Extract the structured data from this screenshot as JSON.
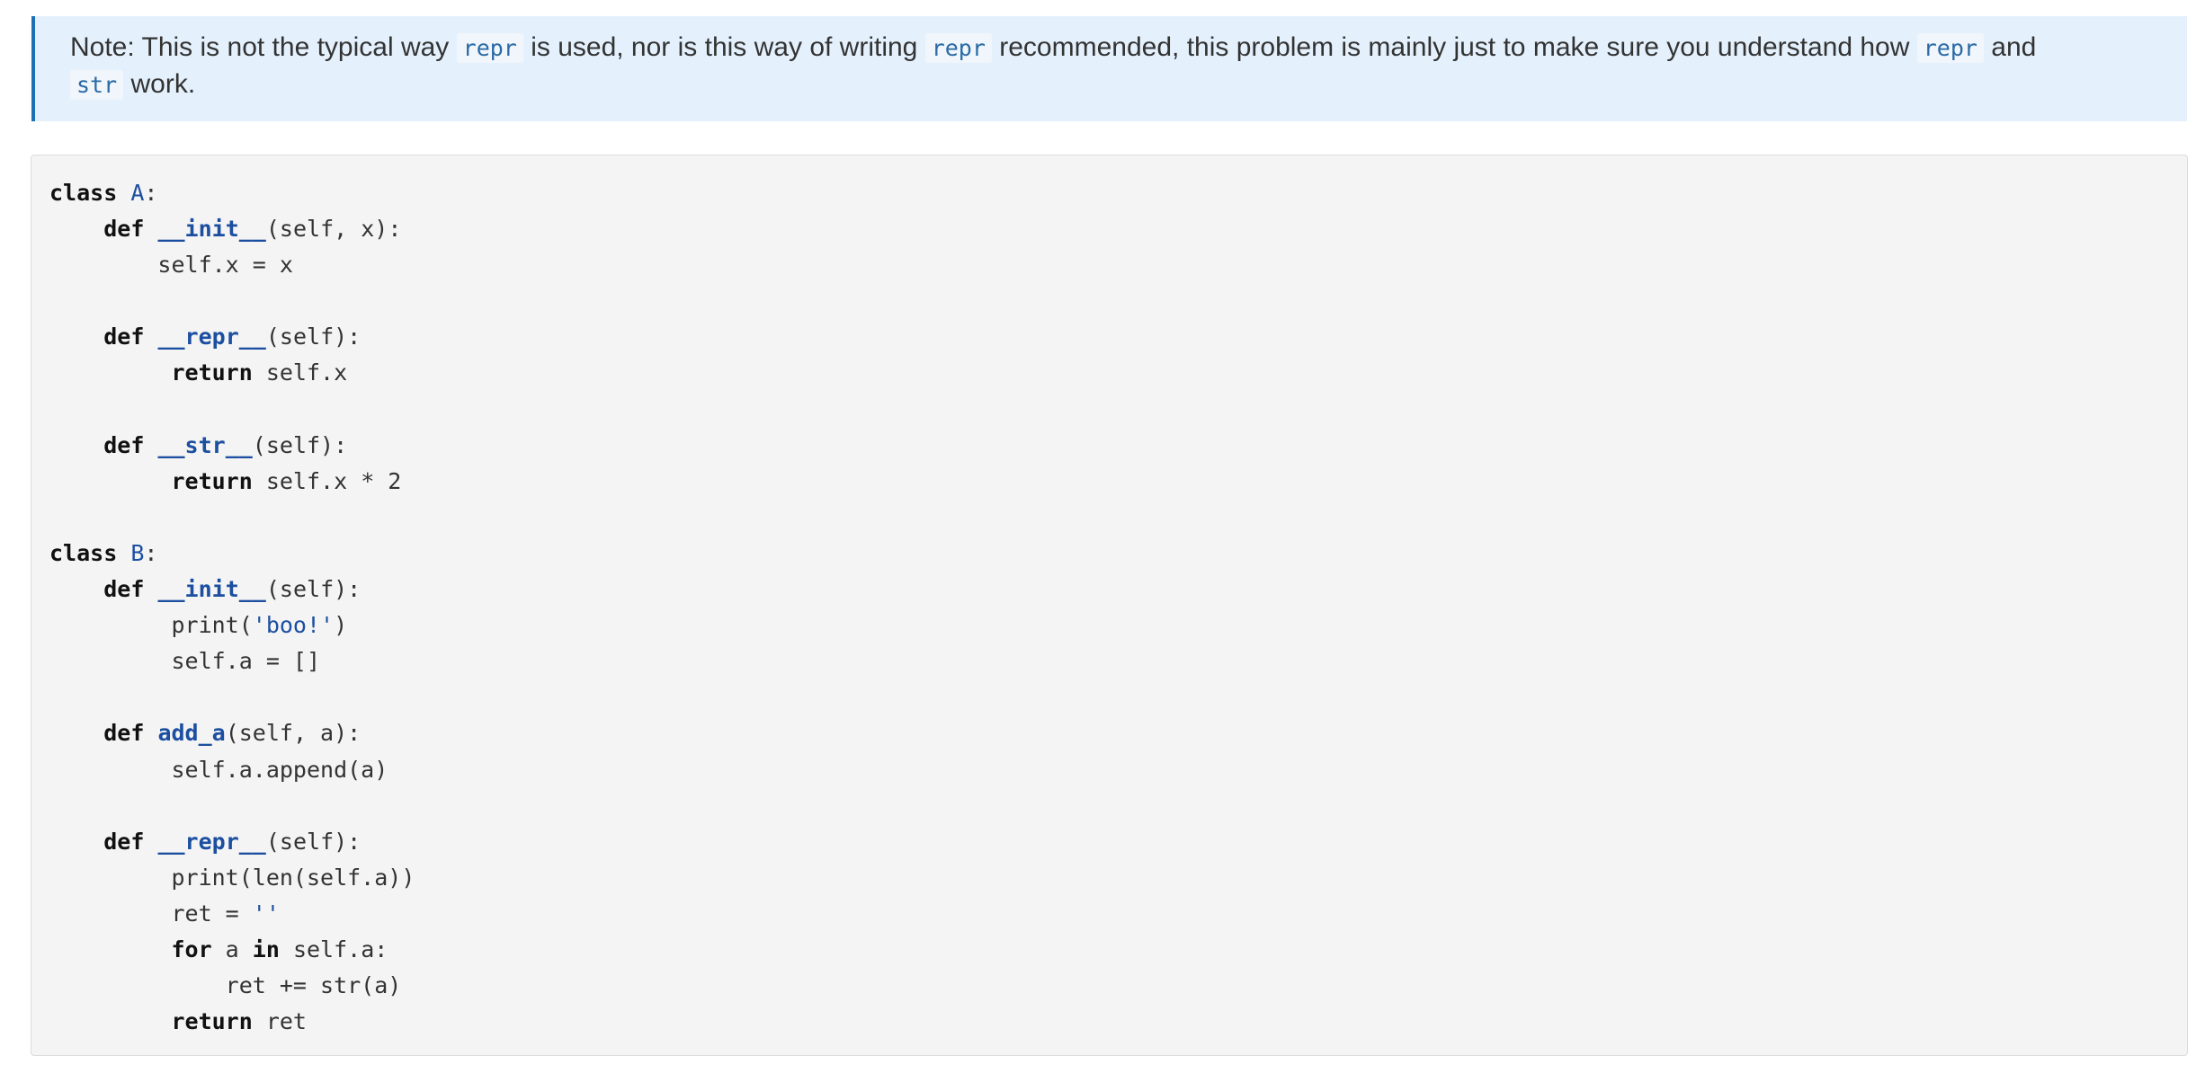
{
  "note": {
    "text_1": "Note: This is not the typical way ",
    "code_1": "repr",
    "text_2": " is used, nor is this way of writing ",
    "code_2": "repr",
    "text_3": " recommended, this problem is mainly just to make sure you understand how ",
    "code_3": "repr",
    "text_4": " and",
    "code_4": "str",
    "text_5": " work."
  },
  "code": {
    "language": "python",
    "lines": [
      [
        [
          "kw",
          "class"
        ],
        [
          "t",
          " "
        ],
        [
          "nm",
          "A"
        ],
        [
          "t",
          ":"
        ]
      ],
      [
        [
          "t",
          "    "
        ],
        [
          "kw",
          "def"
        ],
        [
          "t",
          " "
        ],
        [
          "nmb",
          "__init__"
        ],
        [
          "t",
          "(self, x):"
        ]
      ],
      [
        [
          "t",
          "        self.x = x"
        ]
      ],
      [],
      [
        [
          "t",
          "    "
        ],
        [
          "kw",
          "def"
        ],
        [
          "t",
          " "
        ],
        [
          "nmb",
          "__repr__"
        ],
        [
          "t",
          "(self):"
        ]
      ],
      [
        [
          "t",
          "         "
        ],
        [
          "kw",
          "return"
        ],
        [
          "t",
          " self.x"
        ]
      ],
      [],
      [
        [
          "t",
          "    "
        ],
        [
          "kw",
          "def"
        ],
        [
          "t",
          " "
        ],
        [
          "nmb",
          "__str__"
        ],
        [
          "t",
          "(self):"
        ]
      ],
      [
        [
          "t",
          "         "
        ],
        [
          "kw",
          "return"
        ],
        [
          "t",
          " self.x * 2"
        ]
      ],
      [],
      [
        [
          "kw",
          "class"
        ],
        [
          "t",
          " "
        ],
        [
          "nm",
          "B"
        ],
        [
          "t",
          ":"
        ]
      ],
      [
        [
          "t",
          "    "
        ],
        [
          "kw",
          "def"
        ],
        [
          "t",
          " "
        ],
        [
          "nmb",
          "__init__"
        ],
        [
          "t",
          "(self):"
        ]
      ],
      [
        [
          "t",
          "         print("
        ],
        [
          "st",
          "'boo!'"
        ],
        [
          "t",
          ")"
        ]
      ],
      [
        [
          "t",
          "         self.a = []"
        ]
      ],
      [],
      [
        [
          "t",
          "    "
        ],
        [
          "kw",
          "def"
        ],
        [
          "t",
          " "
        ],
        [
          "nmb",
          "add_a"
        ],
        [
          "t",
          "(self, a):"
        ]
      ],
      [
        [
          "t",
          "         self.a.append(a)"
        ]
      ],
      [],
      [
        [
          "t",
          "    "
        ],
        [
          "kw",
          "def"
        ],
        [
          "t",
          " "
        ],
        [
          "nmb",
          "__repr__"
        ],
        [
          "t",
          "(self):"
        ]
      ],
      [
        [
          "t",
          "         print(len(self.a))"
        ]
      ],
      [
        [
          "t",
          "         ret = "
        ],
        [
          "st",
          "''"
        ]
      ],
      [
        [
          "t",
          "         "
        ],
        [
          "kw",
          "for"
        ],
        [
          "t",
          " a "
        ],
        [
          "kw",
          "in"
        ],
        [
          "t",
          " self.a:"
        ]
      ],
      [
        [
          "t",
          "             ret += str(a)"
        ]
      ],
      [
        [
          "t",
          "         "
        ],
        [
          "kw",
          "return"
        ],
        [
          "t",
          " ret"
        ]
      ]
    ]
  }
}
